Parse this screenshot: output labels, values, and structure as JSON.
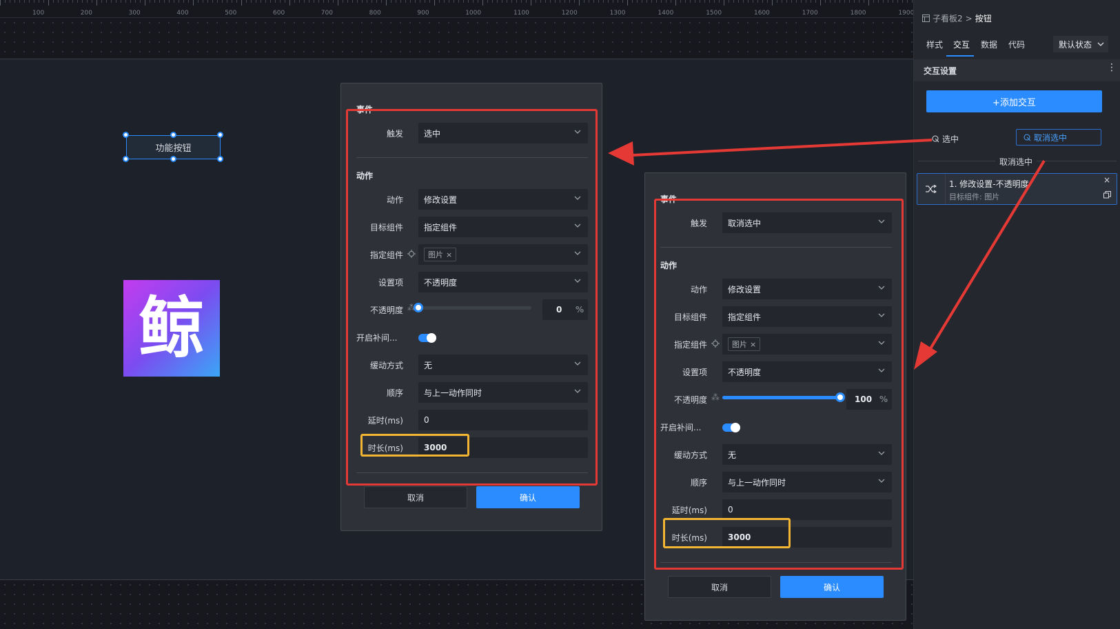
{
  "ruler": {
    "ticks": [
      "100",
      "200",
      "300",
      "400",
      "500",
      "600",
      "700",
      "800",
      "900",
      "1000",
      "1100",
      "1200",
      "1300",
      "1400",
      "1500",
      "1600",
      "1700",
      "1800",
      "1900"
    ]
  },
  "canvas": {
    "selected_button_label": "功能按钮",
    "image_glyph": "鲸"
  },
  "dialog_a": {
    "event_title": "事件",
    "trigger_label": "触发",
    "trigger_value": "选中",
    "action_title": "动作",
    "action_label": "动作",
    "action_value": "修改设置",
    "target_label": "目标组件",
    "target_value": "指定组件",
    "specified_label": "指定组件",
    "specified_tag": "图片",
    "setting_label": "设置项",
    "setting_value": "不透明度",
    "opacity_label": "不透明度",
    "opacity_value": "0",
    "opacity_level": 0,
    "opacity_unit": "%",
    "tween_label": "开启补间...",
    "easing_label": "缓动方式",
    "easing_value": "无",
    "order_label": "顺序",
    "order_value": "与上一动作同时",
    "delay_label": "延时(ms)",
    "delay_value": "0",
    "duration_label": "时长(ms)",
    "duration_value": "3000",
    "cancel_label": "取消",
    "ok_label": "确认"
  },
  "dialog_b": {
    "event_title": "事件",
    "trigger_label": "触发",
    "trigger_value": "取消选中",
    "action_title": "动作",
    "action_label": "动作",
    "action_value": "修改设置",
    "target_label": "目标组件",
    "target_value": "指定组件",
    "specified_label": "指定组件",
    "specified_tag": "图片",
    "setting_label": "设置项",
    "setting_value": "不透明度",
    "opacity_label": "不透明度",
    "opacity_value": "100",
    "opacity_level": 100,
    "opacity_unit": "%",
    "tween_label": "开启补间...",
    "easing_label": "缓动方式",
    "easing_value": "无",
    "order_label": "顺序",
    "order_value": "与上一动作同时",
    "delay_label": "延时(ms)",
    "delay_value": "0",
    "duration_label": "时长(ms)",
    "duration_value": "3000",
    "cancel_label": "取消",
    "ok_label": "确认"
  },
  "panel": {
    "breadcrumb_parent": "子看板2",
    "breadcrumb_sep": ">",
    "breadcrumb_current": "按钮",
    "tabs": [
      "样式",
      "交互",
      "数据",
      "代码"
    ],
    "active_tab": "交互",
    "state_value": "默认状态",
    "section_title": "交互设置",
    "add_label": "+添加交互",
    "event_tabs": [
      "选中",
      "取消选中"
    ],
    "event_section_title": "取消选中",
    "card_title": "1. 修改设置-不透明度",
    "card_subtitle": "目标组件: 图片"
  },
  "colors": {
    "accent": "#2b8cff",
    "annotation_red": "#e53935",
    "annotation_yellow": "#f2b632"
  }
}
